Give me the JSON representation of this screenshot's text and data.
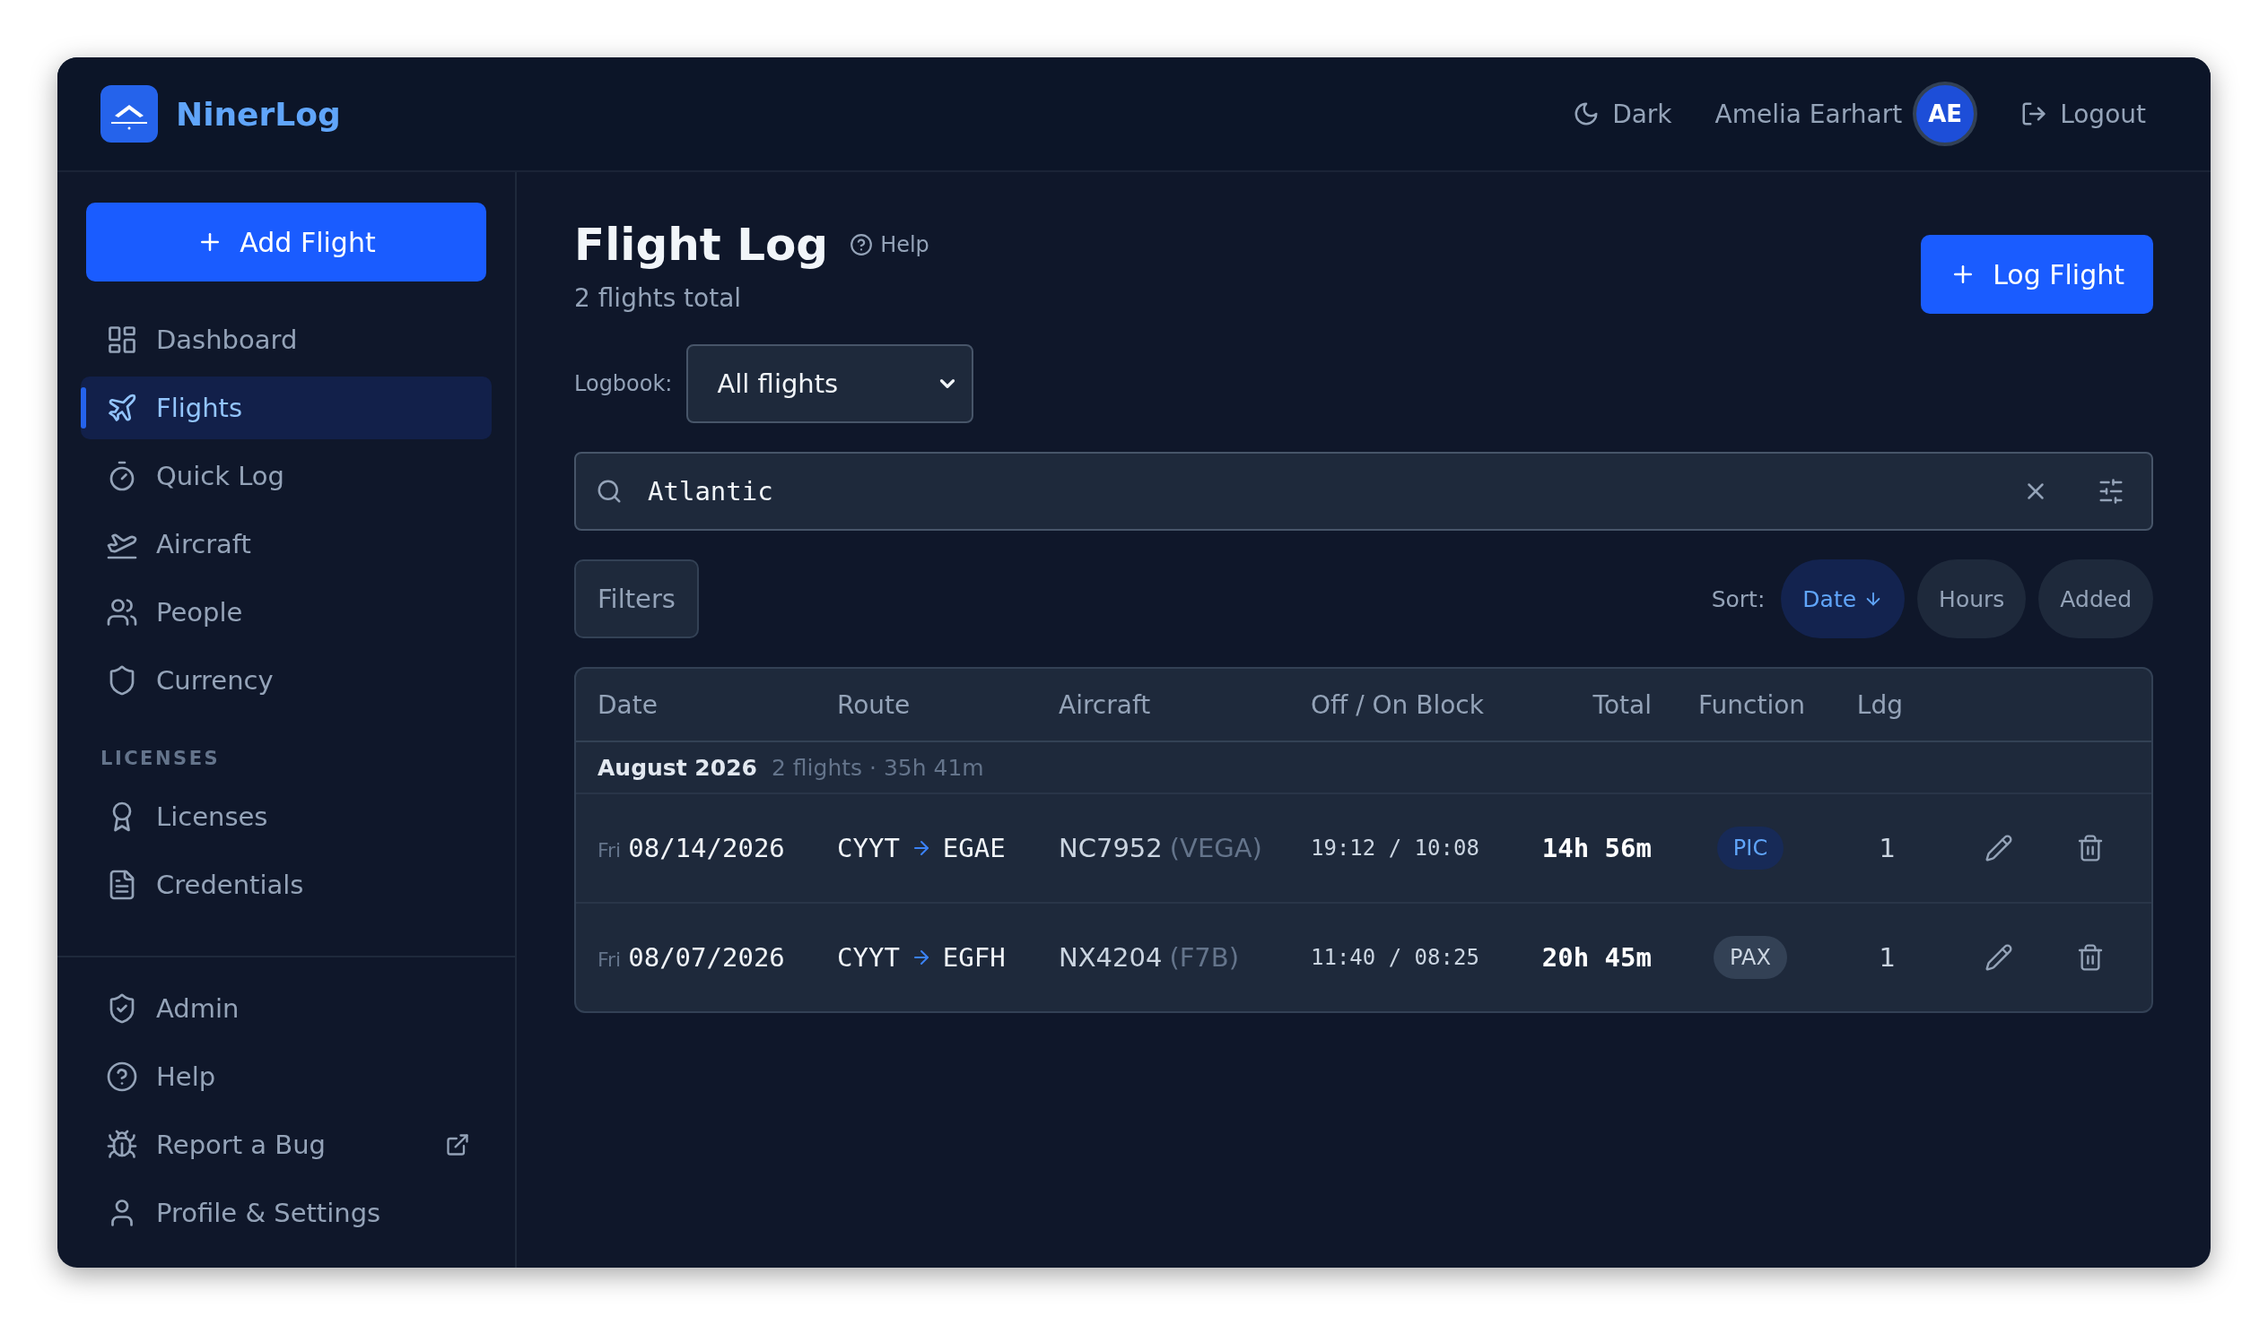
{
  "app": {
    "name": "NinerLog"
  },
  "header": {
    "theme_toggle": "Dark",
    "user": {
      "name": "Amelia Earhart",
      "initials": "AE"
    },
    "logout": "Logout"
  },
  "sidebar": {
    "primary_action": "Add Flight",
    "items": [
      {
        "label": "Dashboard",
        "selected": false
      },
      {
        "label": "Flights",
        "selected": true
      },
      {
        "label": "Quick Log",
        "selected": false
      },
      {
        "label": "Aircraft",
        "selected": false
      },
      {
        "label": "People",
        "selected": false
      },
      {
        "label": "Currency",
        "selected": false
      }
    ],
    "section": {
      "heading": "LICENSES",
      "items": [
        {
          "label": "Licenses",
          "selected": false
        },
        {
          "label": "Credentials",
          "selected": false
        }
      ]
    },
    "bottom_items": [
      {
        "label": "Admin",
        "selected": false,
        "external": false
      },
      {
        "label": "Help",
        "selected": false,
        "external": false
      },
      {
        "label": "Report a Bug",
        "selected": false,
        "external": true
      },
      {
        "label": "Profile & Settings",
        "selected": false,
        "external": false
      }
    ]
  },
  "page": {
    "title": "Flight Log",
    "help": "Help",
    "subtitle": "2 flights total",
    "primary_action": "Log Flight",
    "logbook": {
      "label": "Logbook:",
      "value": "All flights"
    },
    "search": {
      "value": "Atlantic"
    },
    "filters": "Filters",
    "sort_label": "Sort:",
    "sort_options": [
      {
        "label": "Date",
        "selected": true
      },
      {
        "label": "Hours",
        "selected": false
      },
      {
        "label": "Added",
        "selected": false
      }
    ]
  },
  "table": {
    "columns": [
      "Date",
      "Route",
      "Aircraft",
      "Off / On Block",
      "Total",
      "Function",
      "Ldg"
    ],
    "groups": [
      {
        "title": "August 2026",
        "summary": "2 flights · 35h 41m",
        "rows": [
          {
            "day": "Fri",
            "date": "08/14/2026",
            "from": "CYYT",
            "to": "EGAE",
            "aircraft": "NC7952",
            "type": "(VEGA)",
            "off_on": "19:12 / 10:08",
            "total": "14h 56m",
            "function": {
              "label": "PIC",
              "kind": "pic"
            },
            "landings": "1"
          },
          {
            "day": "Fri",
            "date": "08/07/2026",
            "from": "CYYT",
            "to": "EGFH",
            "aircraft": "NX4204",
            "type": "(F7B)",
            "off_on": "11:40 / 08:25",
            "total": "20h 45m",
            "function": {
              "label": "PAX",
              "kind": "pax"
            },
            "landings": "1"
          }
        ]
      }
    ]
  }
}
